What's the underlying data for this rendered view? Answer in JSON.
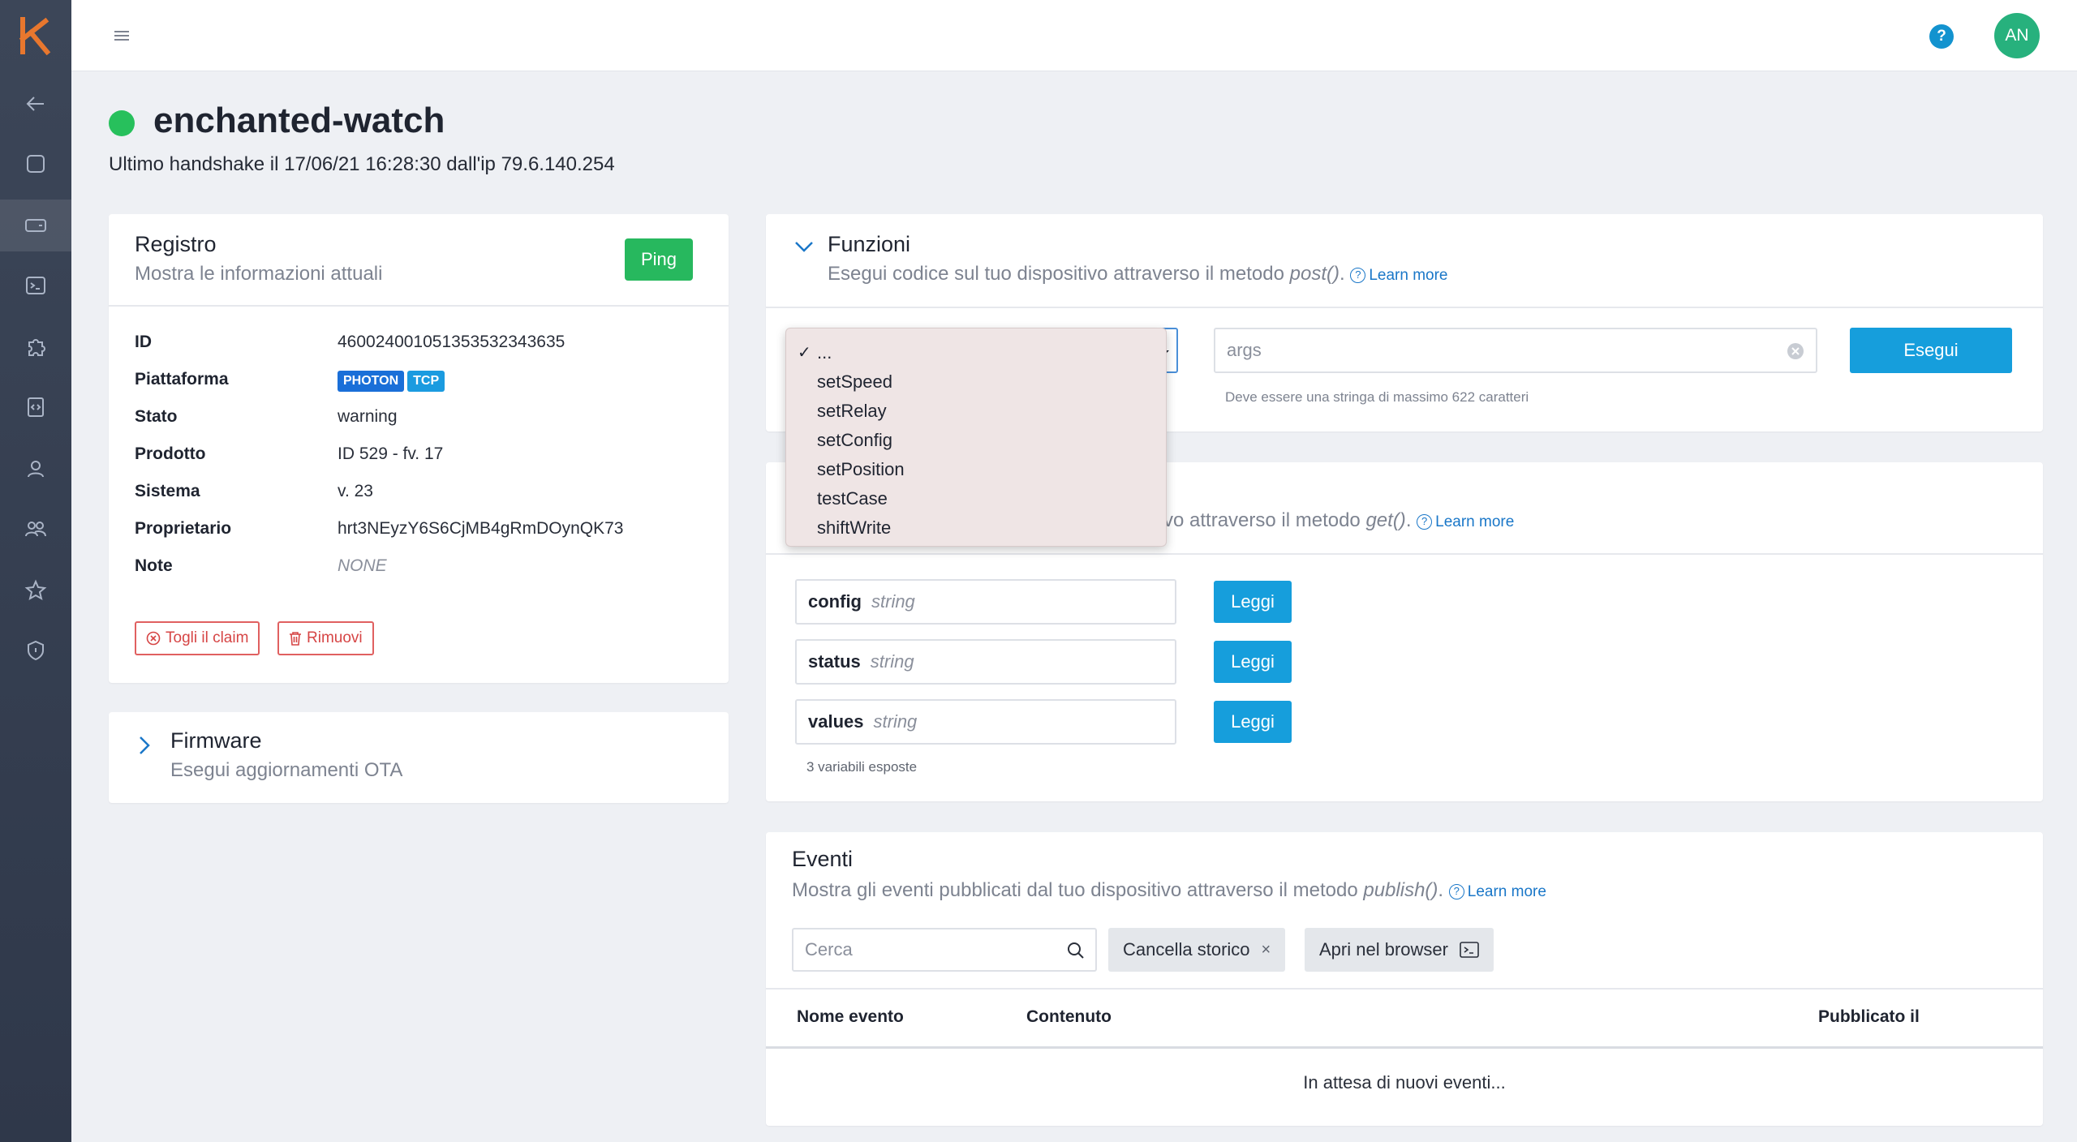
{
  "app": {
    "logo_letter": "k",
    "brand_color": "#e8772e",
    "user_initials": "AN",
    "help_label": "?"
  },
  "sidebar": {
    "items": [
      {
        "icon": "arrow-left-icon"
      },
      {
        "icon": "square-icon"
      },
      {
        "icon": "device-icon",
        "active": true
      },
      {
        "icon": "terminal-icon"
      },
      {
        "icon": "puzzle-icon"
      },
      {
        "icon": "code-file-icon"
      },
      {
        "icon": "user-icon"
      },
      {
        "icon": "users-icon"
      },
      {
        "icon": "star-icon"
      },
      {
        "icon": "shield-icon"
      }
    ]
  },
  "device": {
    "name": "enchanted-watch",
    "status_color": "#27c05c",
    "handshake": "Ultimo handshake il 17/06/21 16:28:30 dall'ip 79.6.140.254"
  },
  "registro": {
    "title": "Registro",
    "subtitle": "Mostra le informazioni attuali",
    "ping_label": "Ping",
    "rows": [
      {
        "label": "ID",
        "value": "460024001051353532343635"
      },
      {
        "label": "Piattaforma",
        "tags": [
          "PHOTON",
          "TCP"
        ]
      },
      {
        "label": "Stato",
        "value": "warning"
      },
      {
        "label": "Prodotto",
        "value": "ID 529 - fv. 17"
      },
      {
        "label": "Sistema",
        "value": "v. 23"
      },
      {
        "label": "Proprietario",
        "value": "hrt3NEyzY6S6CjMB4gRmDOynQK73"
      },
      {
        "label": "Note",
        "value": "NONE"
      }
    ],
    "unclaim_label": "Togli il claim",
    "remove_label": "Rimuovi"
  },
  "firmware": {
    "title": "Firmware",
    "subtitle": "Esegui aggiornamenti OTA"
  },
  "funzioni": {
    "title": "Funzioni",
    "subtitle_pre": "Esegui codice sul tuo dispositivo attraverso il metodo ",
    "subtitle_method": "post()",
    "subtitle_post": ".",
    "learn_more": "Learn more",
    "args_placeholder": "args",
    "args_hint": "Deve essere una stringa di massimo 622 caratteri",
    "run_label": "Esegui",
    "dropdown_options": [
      "...",
      "setSpeed",
      "setRelay",
      "setConfig",
      "setPosition",
      "testCase",
      "shiftWrite"
    ],
    "selected_option": "..."
  },
  "variabili": {
    "subtitle_pre": "vo attraverso il metodo ",
    "subtitle_method": "get()",
    "subtitle_post": ".",
    "learn_more": "Learn more",
    "items": [
      {
        "name": "config",
        "type": "string"
      },
      {
        "name": "status",
        "type": "string"
      },
      {
        "name": "values",
        "type": "string"
      }
    ],
    "read_label": "Leggi",
    "count_text": "3 variabili esposte"
  },
  "eventi": {
    "title": "Eventi",
    "subtitle_pre": "Mostra gli eventi pubblicati dal tuo dispositivo attraverso il metodo ",
    "subtitle_method": "publish()",
    "subtitle_post": ".",
    "learn_more": "Learn more",
    "search_placeholder": "Cerca",
    "clear_label": "Cancella storico",
    "clear_x": "×",
    "browser_label": "Apri nel browser",
    "columns": [
      "Nome evento",
      "Contenuto",
      "Pubblicato il"
    ],
    "empty_text": "In attesa di nuovi eventi..."
  }
}
